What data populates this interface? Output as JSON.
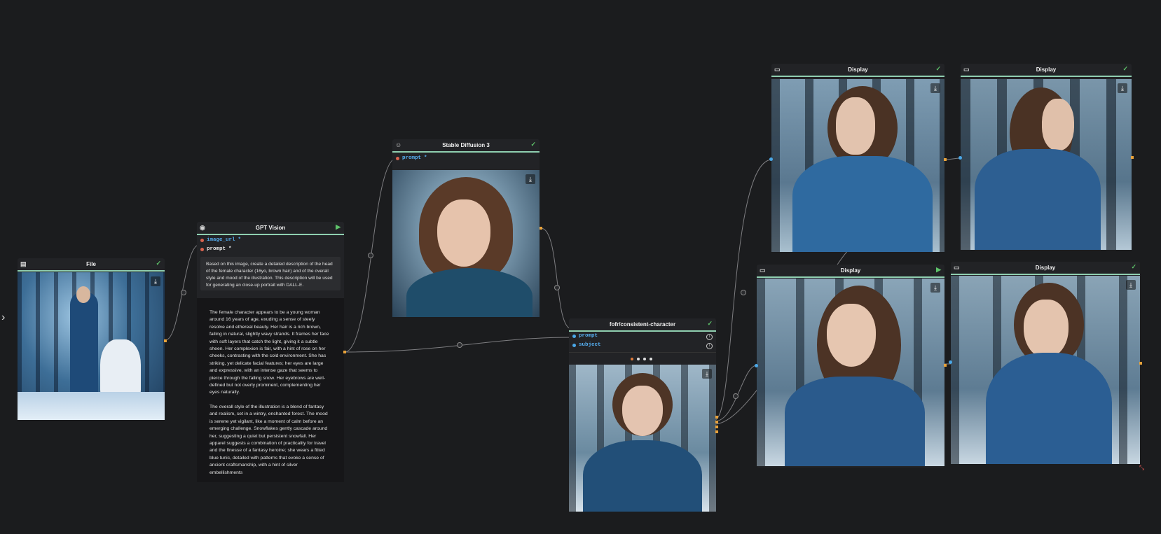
{
  "sidebar": {
    "expand_icon": "chevron-right-icon"
  },
  "nodes": {
    "file": {
      "title": "File",
      "icon": "file-icon",
      "status": "✓"
    },
    "gpt_vision": {
      "title": "GPT Vision",
      "icon": "eye-icon",
      "status": "▶",
      "ports": {
        "image_url": "image_url",
        "prompt": "prompt",
        "required_mark": "*"
      },
      "prompt_text": "Based on this image, create a detailed description of the head of the female character (16yo, brown hair) and of the overall style and mood of the illustration. This description will be used for generating an close-up portrait with DALL-E.",
      "output_paragraphs": [
        "The female character appears to be a young woman around 16 years of age, exuding a sense of steely resolve and ethereal beauty. Her hair is a rich brown, falling in natural, slightly wavy strands. It frames her face with soft layers that catch the light, giving it a subtle sheen. Her complexion is fair, with a hint of rose on her cheeks, contrasting with the cold environment. She has striking, yet delicate facial features; her eyes are large and expressive, with an intense gaze that seems to pierce through the falling snow. Her eyebrows are well-defined but not overly prominent, complementing her eyes naturally.",
        "The overall style of the illustration is a blend of fantasy and realism, set in a wintry, enchanted forest. The mood is serene yet vigilant, like a moment of calm before an emerging challenge. Snowflakes gently cascade around her, suggesting a quiet but persistent snowfall. Her apparel suggests a combination of practicality for travel and the finesse of a fantasy heroine; she wears a fitted blue tunic, detailed with patterns that evoke a sense of ancient craftsmanship, with a hint of silver embellishments"
      ],
      "toolbar": {
        "add": "+",
        "minus": "−",
        "copy": "⧉"
      }
    },
    "sd3": {
      "title": "Stable Diffusion 3",
      "icon": "robot-icon",
      "status": "✓",
      "port": "prompt",
      "required_mark": "*"
    },
    "consistent": {
      "title": "fofr/consistent-character",
      "status": "✓",
      "ports": [
        "prompt",
        "subject"
      ],
      "pages": 4,
      "active_page": 1
    },
    "display1": {
      "title": "Display",
      "icon": "monitor-icon",
      "status": "✓"
    },
    "display2": {
      "title": "Display",
      "icon": "monitor-icon",
      "status": "✓"
    },
    "display3": {
      "title": "Display",
      "icon": "monitor-icon",
      "status": "▶"
    },
    "display4": {
      "title": "Display",
      "icon": "monitor-icon",
      "status": "✓"
    }
  },
  "colors": {
    "bg": "#1b1c1e",
    "accent": "#8fcfb0",
    "wire": "#8a8a8a",
    "port_orange": "#e8a23a",
    "port_blue": "#4aa8e8"
  }
}
